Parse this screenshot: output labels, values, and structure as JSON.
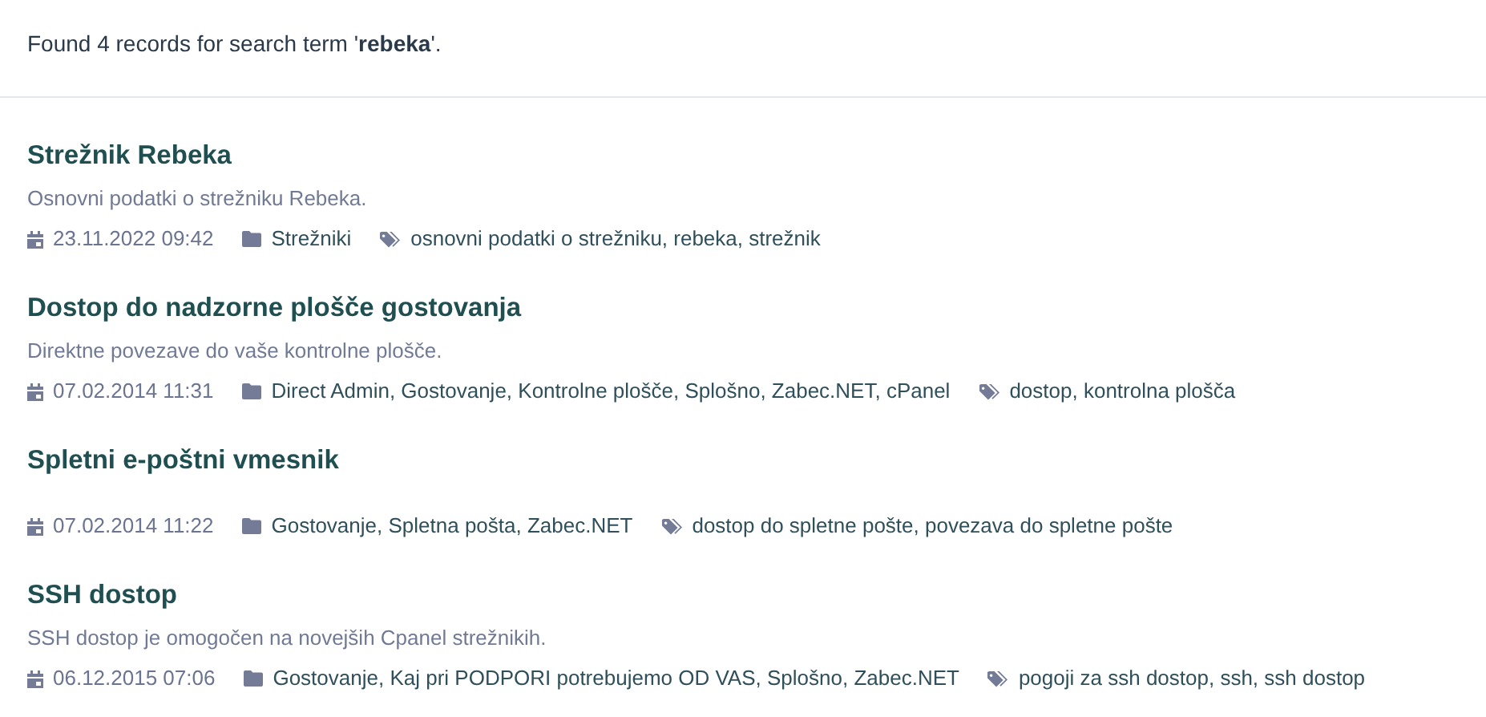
{
  "summary": "Found 4 records for search term '**rebeka**'.",
  "results": [
    {
      "title": "Strežnik Rebeka",
      "description": "Osnovni podatki o strežniku Rebeka.",
      "date": "23.11.2022 09:42",
      "categories": "Strežniki",
      "tags": "osnovni podatki o strežniku, rebeka, strežnik"
    },
    {
      "title": "Dostop do nadzorne plošče gostovanja",
      "description": "Direktne povezave do vaše kontrolne plošče.",
      "date": "07.02.2014 11:31",
      "categories": "Direct Admin, Gostovanje, Kontrolne plošče, Splošno, Zabec.NET, cPanel",
      "tags": "dostop, kontrolna plošča"
    },
    {
      "title": "Spletni e-poštni vmesnik",
      "date": "07.02.2014 11:22",
      "categories": "Gostovanje, Spletna pošta, Zabec.NET",
      "tags": "dostop do spletne pošte, povezava do spletne pošte"
    },
    {
      "title": "SSH dostop",
      "description": "SSH dostop je omogočen na novejših Cpanel strežnikih.",
      "date": "06.12.2015 07:06",
      "categories": "Gostovanje, Kaj pri PODPORI potrebujemo OD VAS, Splošno, Zabec.NET",
      "tags": "pogoji za ssh dostop, ssh, ssh dostop"
    }
  ]
}
